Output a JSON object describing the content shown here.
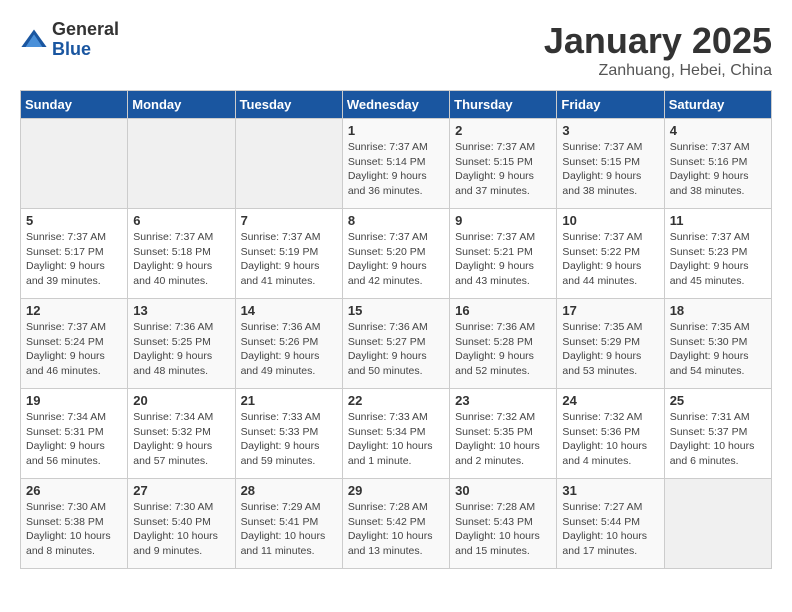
{
  "logo": {
    "general": "General",
    "blue": "Blue"
  },
  "header": {
    "title": "January 2025",
    "subtitle": "Zanhuang, Hebei, China"
  },
  "days_of_week": [
    "Sunday",
    "Monday",
    "Tuesday",
    "Wednesday",
    "Thursday",
    "Friday",
    "Saturday"
  ],
  "weeks": [
    [
      {
        "day": "",
        "info": ""
      },
      {
        "day": "",
        "info": ""
      },
      {
        "day": "",
        "info": ""
      },
      {
        "day": "1",
        "info": "Sunrise: 7:37 AM\nSunset: 5:14 PM\nDaylight: 9 hours and 36 minutes."
      },
      {
        "day": "2",
        "info": "Sunrise: 7:37 AM\nSunset: 5:15 PM\nDaylight: 9 hours and 37 minutes."
      },
      {
        "day": "3",
        "info": "Sunrise: 7:37 AM\nSunset: 5:15 PM\nDaylight: 9 hours and 38 minutes."
      },
      {
        "day": "4",
        "info": "Sunrise: 7:37 AM\nSunset: 5:16 PM\nDaylight: 9 hours and 38 minutes."
      }
    ],
    [
      {
        "day": "5",
        "info": "Sunrise: 7:37 AM\nSunset: 5:17 PM\nDaylight: 9 hours and 39 minutes."
      },
      {
        "day": "6",
        "info": "Sunrise: 7:37 AM\nSunset: 5:18 PM\nDaylight: 9 hours and 40 minutes."
      },
      {
        "day": "7",
        "info": "Sunrise: 7:37 AM\nSunset: 5:19 PM\nDaylight: 9 hours and 41 minutes."
      },
      {
        "day": "8",
        "info": "Sunrise: 7:37 AM\nSunset: 5:20 PM\nDaylight: 9 hours and 42 minutes."
      },
      {
        "day": "9",
        "info": "Sunrise: 7:37 AM\nSunset: 5:21 PM\nDaylight: 9 hours and 43 minutes."
      },
      {
        "day": "10",
        "info": "Sunrise: 7:37 AM\nSunset: 5:22 PM\nDaylight: 9 hours and 44 minutes."
      },
      {
        "day": "11",
        "info": "Sunrise: 7:37 AM\nSunset: 5:23 PM\nDaylight: 9 hours and 45 minutes."
      }
    ],
    [
      {
        "day": "12",
        "info": "Sunrise: 7:37 AM\nSunset: 5:24 PM\nDaylight: 9 hours and 46 minutes."
      },
      {
        "day": "13",
        "info": "Sunrise: 7:36 AM\nSunset: 5:25 PM\nDaylight: 9 hours and 48 minutes."
      },
      {
        "day": "14",
        "info": "Sunrise: 7:36 AM\nSunset: 5:26 PM\nDaylight: 9 hours and 49 minutes."
      },
      {
        "day": "15",
        "info": "Sunrise: 7:36 AM\nSunset: 5:27 PM\nDaylight: 9 hours and 50 minutes."
      },
      {
        "day": "16",
        "info": "Sunrise: 7:36 AM\nSunset: 5:28 PM\nDaylight: 9 hours and 52 minutes."
      },
      {
        "day": "17",
        "info": "Sunrise: 7:35 AM\nSunset: 5:29 PM\nDaylight: 9 hours and 53 minutes."
      },
      {
        "day": "18",
        "info": "Sunrise: 7:35 AM\nSunset: 5:30 PM\nDaylight: 9 hours and 54 minutes."
      }
    ],
    [
      {
        "day": "19",
        "info": "Sunrise: 7:34 AM\nSunset: 5:31 PM\nDaylight: 9 hours and 56 minutes."
      },
      {
        "day": "20",
        "info": "Sunrise: 7:34 AM\nSunset: 5:32 PM\nDaylight: 9 hours and 57 minutes."
      },
      {
        "day": "21",
        "info": "Sunrise: 7:33 AM\nSunset: 5:33 PM\nDaylight: 9 hours and 59 minutes."
      },
      {
        "day": "22",
        "info": "Sunrise: 7:33 AM\nSunset: 5:34 PM\nDaylight: 10 hours and 1 minute."
      },
      {
        "day": "23",
        "info": "Sunrise: 7:32 AM\nSunset: 5:35 PM\nDaylight: 10 hours and 2 minutes."
      },
      {
        "day": "24",
        "info": "Sunrise: 7:32 AM\nSunset: 5:36 PM\nDaylight: 10 hours and 4 minutes."
      },
      {
        "day": "25",
        "info": "Sunrise: 7:31 AM\nSunset: 5:37 PM\nDaylight: 10 hours and 6 minutes."
      }
    ],
    [
      {
        "day": "26",
        "info": "Sunrise: 7:30 AM\nSunset: 5:38 PM\nDaylight: 10 hours and 8 minutes."
      },
      {
        "day": "27",
        "info": "Sunrise: 7:30 AM\nSunset: 5:40 PM\nDaylight: 10 hours and 9 minutes."
      },
      {
        "day": "28",
        "info": "Sunrise: 7:29 AM\nSunset: 5:41 PM\nDaylight: 10 hours and 11 minutes."
      },
      {
        "day": "29",
        "info": "Sunrise: 7:28 AM\nSunset: 5:42 PM\nDaylight: 10 hours and 13 minutes."
      },
      {
        "day": "30",
        "info": "Sunrise: 7:28 AM\nSunset: 5:43 PM\nDaylight: 10 hours and 15 minutes."
      },
      {
        "day": "31",
        "info": "Sunrise: 7:27 AM\nSunset: 5:44 PM\nDaylight: 10 hours and 17 minutes."
      },
      {
        "day": "",
        "info": ""
      }
    ]
  ]
}
